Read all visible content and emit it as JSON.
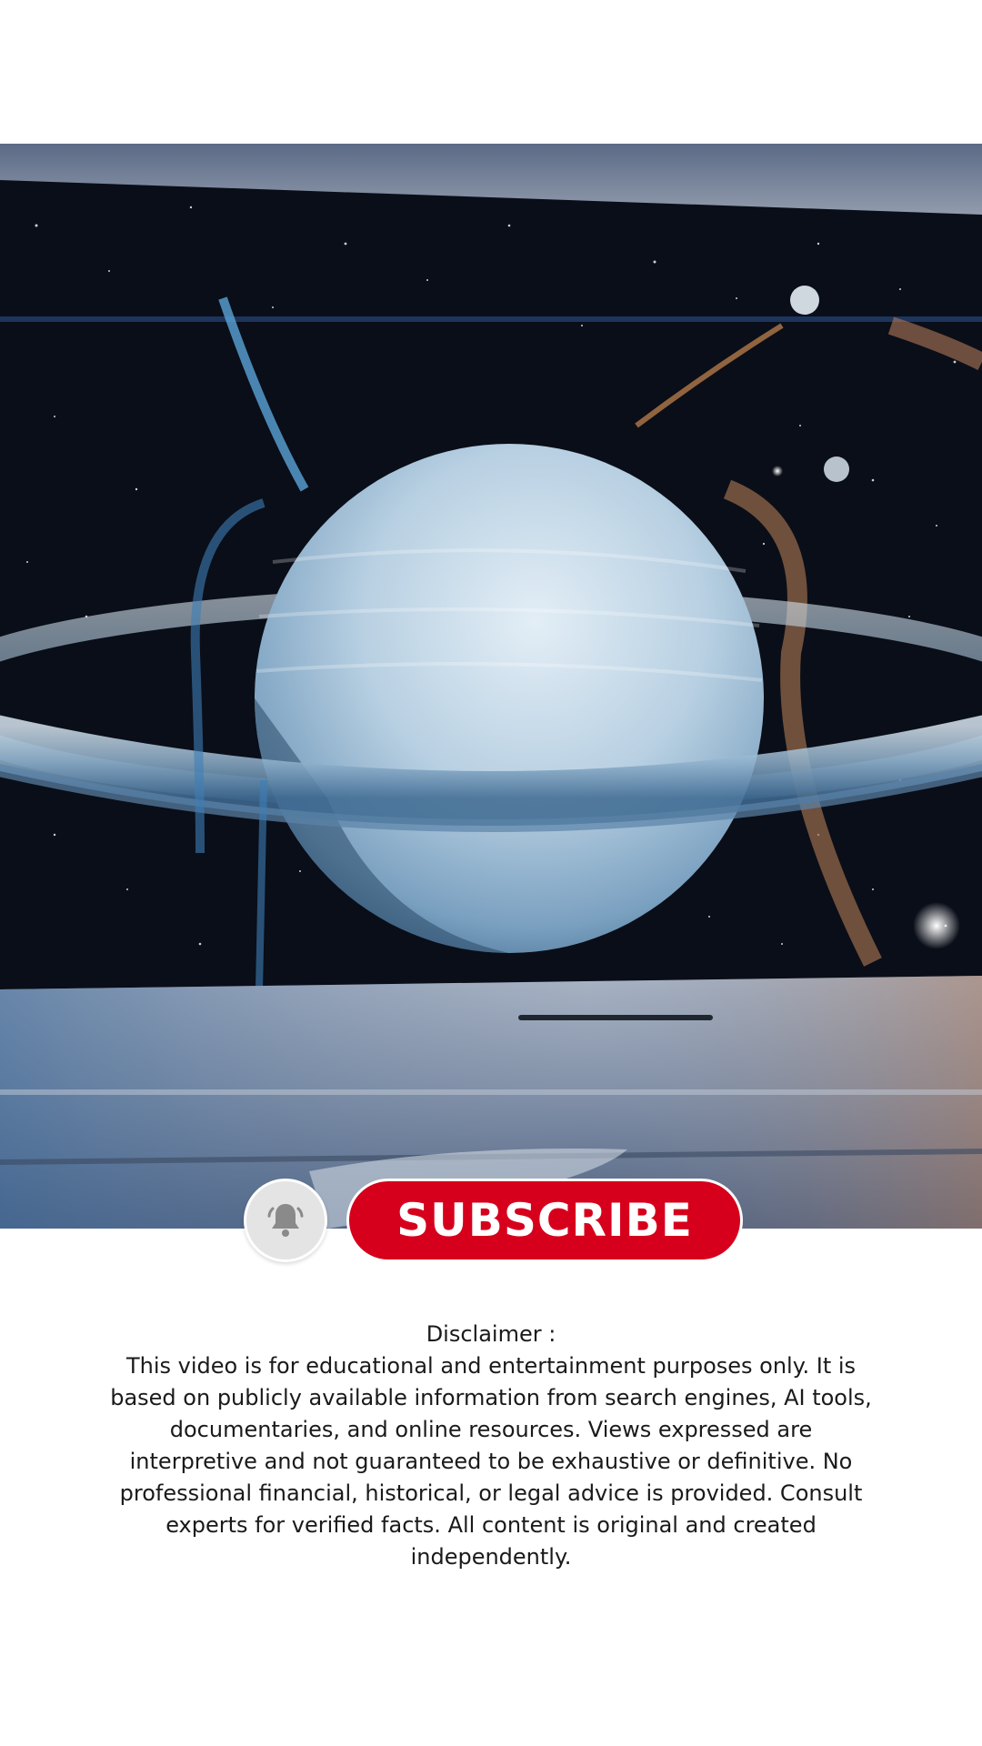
{
  "video": {
    "scene": "ringed-planet-in-space"
  },
  "subscribe": {
    "bell_icon": "bell-icon",
    "label": "SUBSCRIBE",
    "color": "#d6001c"
  },
  "disclaimer": {
    "title": "Disclaimer :",
    "body": "This video is for educational and entertainment purposes only. It is based on publicly available information from search engines, AI tools, documentaries, and online resources. Views expressed are interpretive and not guaranteed to be exhaustive or definitive. No professional financial, historical, or legal advice is provided. Consult experts for verified facts. All content is original and created independently."
  }
}
